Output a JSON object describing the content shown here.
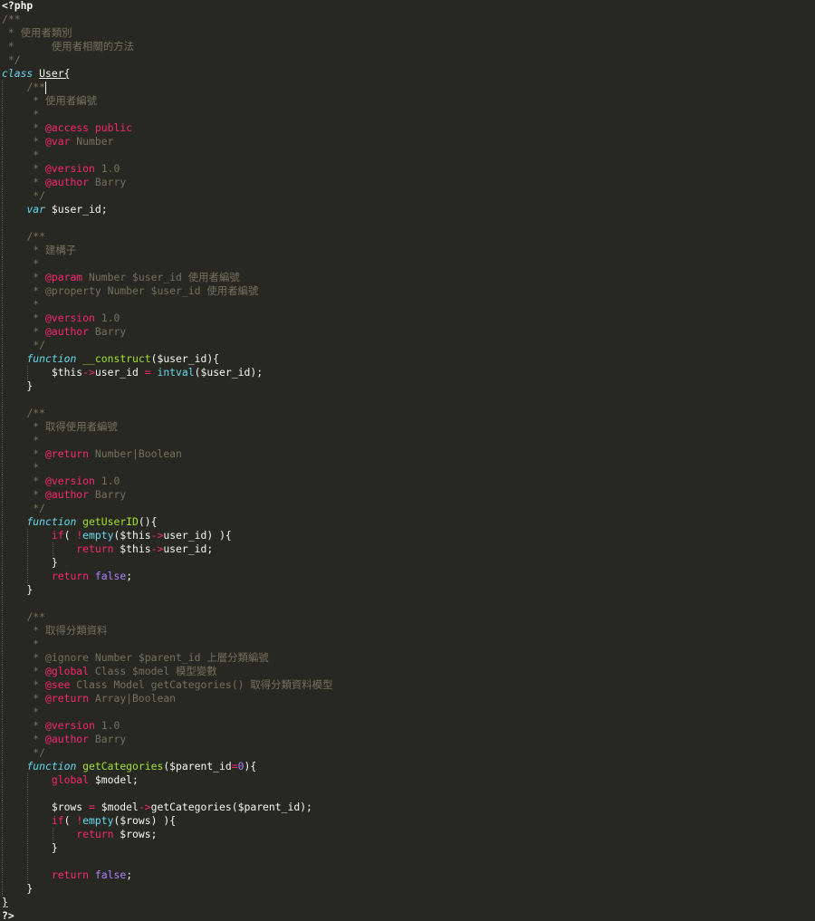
{
  "editor": {
    "language": "PHP",
    "theme_colors": {
      "background": "#272822",
      "foreground": "#f8f8f2",
      "comment": "#75715e",
      "keyword": "#f92672",
      "storage": "#66d9ef",
      "function": "#a6e22e",
      "constant": "#ae81ff"
    },
    "lines": [
      {
        "t": [
          [
            "php",
            "<?php"
          ]
        ]
      },
      {
        "t": [
          [
            "comment",
            "/**"
          ]
        ]
      },
      {
        "t": [
          [
            "comment",
            " * "
          ],
          [
            "cjk",
            "使用者類別"
          ]
        ]
      },
      {
        "t": [
          [
            "comment",
            " *      "
          ],
          [
            "cjk",
            "使用者相關的方法"
          ]
        ]
      },
      {
        "t": [
          [
            "comment",
            " */"
          ]
        ]
      },
      {
        "t": [
          [
            "storage",
            "class"
          ],
          [
            "plain",
            " "
          ],
          [
            "classname-underline",
            "User"
          ],
          [
            "brace-underline",
            "{"
          ]
        ]
      },
      {
        "g": [
          1
        ],
        "t": [
          [
            "plain",
            "    "
          ],
          [
            "comment",
            "/**"
          ]
        ]
      },
      {
        "g": [
          1
        ],
        "t": [
          [
            "plain",
            "     "
          ],
          [
            "comment",
            "* "
          ],
          [
            "cjk",
            "使用者編號"
          ]
        ]
      },
      {
        "g": [
          1
        ],
        "t": [
          [
            "plain",
            "     "
          ],
          [
            "comment",
            "*"
          ]
        ]
      },
      {
        "g": [
          1
        ],
        "t": [
          [
            "plain",
            "     "
          ],
          [
            "comment",
            "* "
          ],
          [
            "tag",
            "@access"
          ],
          [
            "comment",
            " "
          ],
          [
            "keyword",
            "public"
          ]
        ]
      },
      {
        "g": [
          1
        ],
        "t": [
          [
            "plain",
            "     "
          ],
          [
            "comment",
            "* "
          ],
          [
            "tag",
            "@var"
          ],
          [
            "comment",
            " Number"
          ]
        ]
      },
      {
        "g": [
          1
        ],
        "t": [
          [
            "plain",
            "     "
          ],
          [
            "comment",
            "*"
          ]
        ]
      },
      {
        "g": [
          1
        ],
        "t": [
          [
            "plain",
            "     "
          ],
          [
            "comment",
            "* "
          ],
          [
            "tag",
            "@version"
          ],
          [
            "comment",
            " 1.0"
          ]
        ]
      },
      {
        "g": [
          1
        ],
        "t": [
          [
            "plain",
            "     "
          ],
          [
            "comment",
            "* "
          ],
          [
            "tag",
            "@author"
          ],
          [
            "comment",
            " Barry"
          ]
        ]
      },
      {
        "g": [
          1
        ],
        "t": [
          [
            "plain",
            "     "
          ],
          [
            "comment",
            "*/"
          ]
        ]
      },
      {
        "g": [
          1
        ],
        "t": [
          [
            "plain",
            "    "
          ],
          [
            "storage",
            "var"
          ],
          [
            "plain",
            " $user_id;"
          ]
        ]
      },
      {
        "g": [
          1
        ],
        "t": [
          [
            "plain",
            ""
          ]
        ]
      },
      {
        "g": [
          1
        ],
        "t": [
          [
            "plain",
            "    "
          ],
          [
            "comment",
            "/**"
          ]
        ]
      },
      {
        "g": [
          1
        ],
        "t": [
          [
            "plain",
            "     "
          ],
          [
            "comment",
            "* "
          ],
          [
            "cjk",
            "建構子"
          ]
        ]
      },
      {
        "g": [
          1
        ],
        "t": [
          [
            "plain",
            "     "
          ],
          [
            "comment",
            "*"
          ]
        ]
      },
      {
        "g": [
          1
        ],
        "t": [
          [
            "plain",
            "     "
          ],
          [
            "comment",
            "* "
          ],
          [
            "tag",
            "@param"
          ],
          [
            "comment",
            " Number $user_id "
          ],
          [
            "cjk",
            "使用者編號"
          ]
        ]
      },
      {
        "g": [
          1
        ],
        "t": [
          [
            "plain",
            "     "
          ],
          [
            "comment",
            "* @property Number $user_id "
          ],
          [
            "cjk",
            "使用者編號"
          ]
        ]
      },
      {
        "g": [
          1
        ],
        "t": [
          [
            "plain",
            "     "
          ],
          [
            "comment",
            "*"
          ]
        ]
      },
      {
        "g": [
          1
        ],
        "t": [
          [
            "plain",
            "     "
          ],
          [
            "comment",
            "* "
          ],
          [
            "tag",
            "@version"
          ],
          [
            "comment",
            " 1.0"
          ]
        ]
      },
      {
        "g": [
          1
        ],
        "t": [
          [
            "plain",
            "     "
          ],
          [
            "comment",
            "* "
          ],
          [
            "tag",
            "@author"
          ],
          [
            "comment",
            " Barry"
          ]
        ]
      },
      {
        "g": [
          1
        ],
        "t": [
          [
            "plain",
            "     "
          ],
          [
            "comment",
            "*/"
          ]
        ]
      },
      {
        "g": [
          1
        ],
        "t": [
          [
            "plain",
            "    "
          ],
          [
            "storage",
            "function"
          ],
          [
            "plain",
            " "
          ],
          [
            "func",
            "__construct"
          ],
          [
            "plain",
            "($user_id){"
          ]
        ]
      },
      {
        "g": [
          1,
          2
        ],
        "t": [
          [
            "plain",
            "        $this"
          ],
          [
            "operator",
            "->"
          ],
          [
            "plain",
            "user_id "
          ],
          [
            "operator",
            "="
          ],
          [
            "plain",
            " "
          ],
          [
            "builtin",
            "intval"
          ],
          [
            "plain",
            "($user_id);"
          ]
        ]
      },
      {
        "g": [
          1
        ],
        "t": [
          [
            "plain",
            "    }"
          ]
        ]
      },
      {
        "g": [
          1
        ],
        "t": [
          [
            "plain",
            ""
          ]
        ]
      },
      {
        "g": [
          1
        ],
        "t": [
          [
            "plain",
            "    "
          ],
          [
            "comment",
            "/**"
          ]
        ]
      },
      {
        "g": [
          1
        ],
        "t": [
          [
            "plain",
            "     "
          ],
          [
            "comment",
            "* "
          ],
          [
            "cjk",
            "取得使用者編號"
          ]
        ]
      },
      {
        "g": [
          1
        ],
        "t": [
          [
            "plain",
            "     "
          ],
          [
            "comment",
            "*"
          ]
        ]
      },
      {
        "g": [
          1
        ],
        "t": [
          [
            "plain",
            "     "
          ],
          [
            "comment",
            "* "
          ],
          [
            "tag",
            "@return"
          ],
          [
            "comment",
            " Number|Boolean"
          ]
        ]
      },
      {
        "g": [
          1
        ],
        "t": [
          [
            "plain",
            "     "
          ],
          [
            "comment",
            "*"
          ]
        ]
      },
      {
        "g": [
          1
        ],
        "t": [
          [
            "plain",
            "     "
          ],
          [
            "comment",
            "* "
          ],
          [
            "tag",
            "@version"
          ],
          [
            "comment",
            " 1.0"
          ]
        ]
      },
      {
        "g": [
          1
        ],
        "t": [
          [
            "plain",
            "     "
          ],
          [
            "comment",
            "* "
          ],
          [
            "tag",
            "@author"
          ],
          [
            "comment",
            " Barry"
          ]
        ]
      },
      {
        "g": [
          1
        ],
        "t": [
          [
            "plain",
            "     "
          ],
          [
            "comment",
            "*/"
          ]
        ]
      },
      {
        "g": [
          1
        ],
        "t": [
          [
            "plain",
            "    "
          ],
          [
            "storage",
            "function"
          ],
          [
            "plain",
            " "
          ],
          [
            "func",
            "getUserID"
          ],
          [
            "plain",
            "(){"
          ]
        ]
      },
      {
        "g": [
          1,
          2
        ],
        "t": [
          [
            "plain",
            "        "
          ],
          [
            "keyword",
            "if"
          ],
          [
            "plain",
            "( "
          ],
          [
            "operator",
            "!"
          ],
          [
            "builtin",
            "empty"
          ],
          [
            "plain",
            "($this"
          ],
          [
            "operator",
            "->"
          ],
          [
            "plain",
            "user_id) ){"
          ]
        ]
      },
      {
        "g": [
          1,
          2,
          3
        ],
        "t": [
          [
            "plain",
            "            "
          ],
          [
            "keyword",
            "return"
          ],
          [
            "plain",
            " $this"
          ],
          [
            "operator",
            "->"
          ],
          [
            "plain",
            "user_id;"
          ]
        ]
      },
      {
        "g": [
          1,
          2
        ],
        "t": [
          [
            "plain",
            "        }"
          ]
        ]
      },
      {
        "g": [
          1,
          2
        ],
        "t": [
          [
            "plain",
            "        "
          ],
          [
            "keyword",
            "return"
          ],
          [
            "plain",
            " "
          ],
          [
            "const",
            "false"
          ],
          [
            "plain",
            ";"
          ]
        ]
      },
      {
        "g": [
          1
        ],
        "t": [
          [
            "plain",
            "    }"
          ]
        ]
      },
      {
        "g": [
          1
        ],
        "t": [
          [
            "plain",
            ""
          ]
        ]
      },
      {
        "g": [
          1
        ],
        "t": [
          [
            "plain",
            "    "
          ],
          [
            "comment",
            "/**"
          ]
        ]
      },
      {
        "g": [
          1
        ],
        "t": [
          [
            "plain",
            "     "
          ],
          [
            "comment",
            "* "
          ],
          [
            "cjk",
            "取得分類資料"
          ]
        ]
      },
      {
        "g": [
          1
        ],
        "t": [
          [
            "plain",
            "     "
          ],
          [
            "comment",
            "*"
          ]
        ]
      },
      {
        "g": [
          1
        ],
        "t": [
          [
            "plain",
            "     "
          ],
          [
            "comment",
            "* @ignore Number $parent_id "
          ],
          [
            "cjk",
            "上層分類編號"
          ]
        ]
      },
      {
        "g": [
          1
        ],
        "t": [
          [
            "plain",
            "     "
          ],
          [
            "comment",
            "* "
          ],
          [
            "tag",
            "@global"
          ],
          [
            "comment",
            " Class $model "
          ],
          [
            "cjk",
            "模型變數"
          ]
        ]
      },
      {
        "g": [
          1
        ],
        "t": [
          [
            "plain",
            "     "
          ],
          [
            "comment",
            "* "
          ],
          [
            "tag",
            "@see"
          ],
          [
            "comment",
            " Class Model getCategories() "
          ],
          [
            "cjk",
            "取得分類資料模型"
          ]
        ]
      },
      {
        "g": [
          1
        ],
        "t": [
          [
            "plain",
            "     "
          ],
          [
            "comment",
            "* "
          ],
          [
            "tag",
            "@return"
          ],
          [
            "comment",
            " Array|Boolean"
          ]
        ]
      },
      {
        "g": [
          1
        ],
        "t": [
          [
            "plain",
            "     "
          ],
          [
            "comment",
            "*"
          ]
        ]
      },
      {
        "g": [
          1
        ],
        "t": [
          [
            "plain",
            "     "
          ],
          [
            "comment",
            "* "
          ],
          [
            "tag",
            "@version"
          ],
          [
            "comment",
            " 1.0"
          ]
        ]
      },
      {
        "g": [
          1
        ],
        "t": [
          [
            "plain",
            "     "
          ],
          [
            "comment",
            "* "
          ],
          [
            "tag",
            "@author"
          ],
          [
            "comment",
            " Barry"
          ]
        ]
      },
      {
        "g": [
          1
        ],
        "t": [
          [
            "plain",
            "     "
          ],
          [
            "comment",
            "*/"
          ]
        ]
      },
      {
        "g": [
          1
        ],
        "t": [
          [
            "plain",
            "    "
          ],
          [
            "storage",
            "function"
          ],
          [
            "plain",
            " "
          ],
          [
            "func",
            "getCategories"
          ],
          [
            "plain",
            "($parent_id"
          ],
          [
            "operator",
            "="
          ],
          [
            "const",
            "0"
          ],
          [
            "plain",
            "){"
          ]
        ]
      },
      {
        "g": [
          1,
          2
        ],
        "t": [
          [
            "plain",
            "        "
          ],
          [
            "keyword",
            "global"
          ],
          [
            "plain",
            " $model;"
          ]
        ]
      },
      {
        "g": [
          1,
          2
        ],
        "t": [
          [
            "plain",
            ""
          ]
        ]
      },
      {
        "g": [
          1,
          2
        ],
        "t": [
          [
            "plain",
            "        $rows "
          ],
          [
            "operator",
            "="
          ],
          [
            "plain",
            " $model"
          ],
          [
            "operator",
            "->"
          ],
          [
            "plain",
            "getCategories($parent_id);"
          ]
        ]
      },
      {
        "g": [
          1,
          2
        ],
        "t": [
          [
            "plain",
            "        "
          ],
          [
            "keyword",
            "if"
          ],
          [
            "plain",
            "( "
          ],
          [
            "operator",
            "!"
          ],
          [
            "builtin",
            "empty"
          ],
          [
            "plain",
            "($rows) ){"
          ]
        ]
      },
      {
        "g": [
          1,
          2,
          3
        ],
        "t": [
          [
            "plain",
            "            "
          ],
          [
            "keyword",
            "return"
          ],
          [
            "plain",
            " $rows;"
          ]
        ]
      },
      {
        "g": [
          1,
          2
        ],
        "t": [
          [
            "plain",
            "        }"
          ]
        ]
      },
      {
        "g": [
          1,
          2
        ],
        "t": [
          [
            "plain",
            ""
          ]
        ]
      },
      {
        "g": [
          1,
          2
        ],
        "t": [
          [
            "plain",
            "        "
          ],
          [
            "keyword",
            "return"
          ],
          [
            "plain",
            " "
          ],
          [
            "const",
            "false"
          ],
          [
            "plain",
            ";"
          ]
        ]
      },
      {
        "g": [
          1
        ],
        "t": [
          [
            "plain",
            "    }"
          ]
        ]
      },
      {
        "t": [
          [
            "brace-underline",
            "}"
          ]
        ]
      },
      {
        "t": [
          [
            "php",
            "?>"
          ]
        ]
      }
    ]
  }
}
